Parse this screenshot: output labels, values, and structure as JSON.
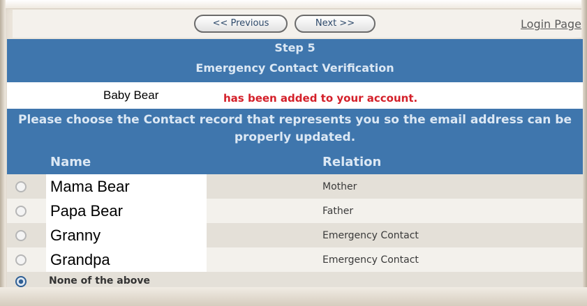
{
  "nav": {
    "previous": "<< Previous",
    "next": "Next >>",
    "login": "Login Page"
  },
  "step": {
    "title": "Step 5",
    "subtitle": "Emergency Contact Verification"
  },
  "added": {
    "name": "Baby Bear",
    "message": "has been added to your account."
  },
  "instruction": "Please choose the Contact record that represents you so the email address can be properly updated.",
  "table": {
    "headers": [
      "Name",
      "Relation"
    ],
    "rows": [
      {
        "name": "Mama Bear",
        "relation": "Mother"
      },
      {
        "name": "Papa Bear",
        "relation": "Father"
      },
      {
        "name": "Granny",
        "relation": "Emergency Contact"
      },
      {
        "name": "Grandpa",
        "relation": "Emergency Contact"
      }
    ],
    "none_option": "None of the above"
  },
  "colors": {
    "header_blue": "#3f76ad",
    "alert_red": "#d4202a"
  }
}
